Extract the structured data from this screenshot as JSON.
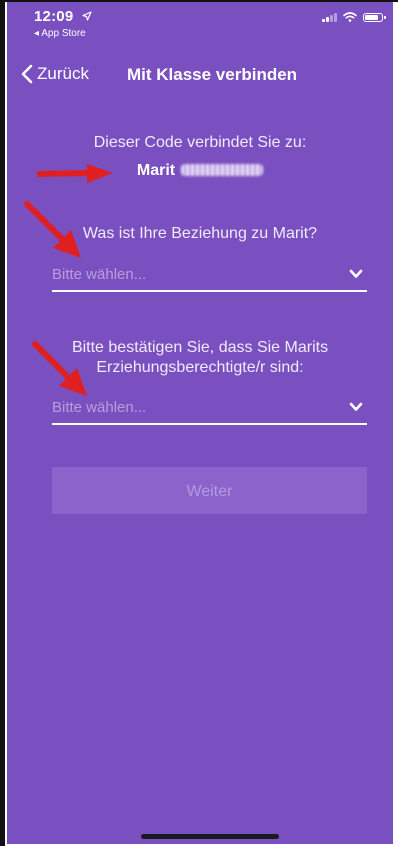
{
  "status_bar": {
    "time": "12:09",
    "location_arrow": "location-arrow-icon",
    "back_to_app": "◂ App Store",
    "signal_icon": "cellular-signal-icon",
    "wifi_icon": "wifi-icon",
    "battery_icon": "battery-icon"
  },
  "nav": {
    "back_label": "Zurück",
    "title": "Mit Klasse verbinden"
  },
  "connection": {
    "code_label": "Dieser Code verbindet Sie zu:",
    "student_first_name": "Marit"
  },
  "relationship": {
    "question": "Was ist Ihre Beziehung zu Marit?",
    "placeholder": "Bitte wählen..."
  },
  "guardian": {
    "question": "Bitte bestätigen Sie, dass Sie Marits Erziehungsberechtigte/r sind:",
    "placeholder": "Bitte wählen..."
  },
  "actions": {
    "continue_label": "Weiter"
  },
  "colors": {
    "background": "#7a4fc0",
    "button_disabled": "#8b63cb",
    "annotation_arrow": "#e02020"
  }
}
